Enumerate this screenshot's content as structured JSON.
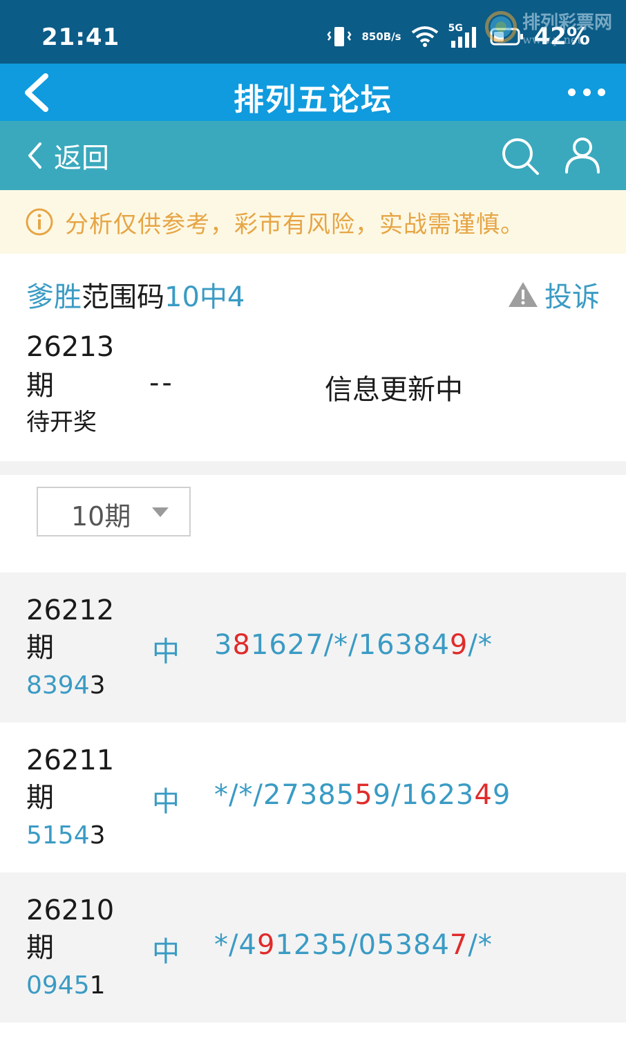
{
  "status_bar": {
    "time": "21:41",
    "speed_value": "850",
    "speed_unit": "B/s",
    "network": "5G",
    "battery": "42%",
    "watermark_text": "排列彩票网",
    "watermark_url": "www.p.net"
  },
  "title_bar": {
    "title": "排列五论坛"
  },
  "sub_nav": {
    "back_label": "返回"
  },
  "notice": {
    "text": "分析仅供参考，彩市有风险，实战需谨慎。"
  },
  "header": {
    "title_part1": "爹胜",
    "title_part2": "范围码",
    "title_part3": "10中4",
    "complain_label": "投诉"
  },
  "current": {
    "issue_number": "26213",
    "issue_suffix": "期",
    "status": "待开奖",
    "hit": "--",
    "info": "信息更新中"
  },
  "filter": {
    "selected": "10期"
  },
  "colors": {
    "status_bar": "#0b5c87",
    "title_bar": "#0f9bde",
    "sub_nav": "#3aa9bd",
    "notice_bg": "#fdf8e4",
    "notice_text": "#e6a545",
    "accent_blue": "#3a9bc4",
    "highlight_red": "#e02b2b"
  },
  "records": [
    {
      "issue_number": "26212",
      "issue_suffix": "期",
      "hit": "中",
      "draw": [
        {
          "t": "8394",
          "c": "blue"
        },
        {
          "t": "3",
          "c": "dark"
        }
      ],
      "prediction": [
        {
          "t": "3",
          "c": "blue"
        },
        {
          "t": "8",
          "c": "red"
        },
        {
          "t": "1627/*/16384",
          "c": "blue"
        },
        {
          "t": "9",
          "c": "red"
        },
        {
          "t": "/*",
          "c": "blue"
        }
      ]
    },
    {
      "issue_number": "26211",
      "issue_suffix": "期",
      "hit": "中",
      "draw": [
        {
          "t": "5154",
          "c": "blue"
        },
        {
          "t": "3",
          "c": "dark"
        }
      ],
      "prediction": [
        {
          "t": "*/*/27385",
          "c": "blue"
        },
        {
          "t": "5",
          "c": "red"
        },
        {
          "t": "9/1623",
          "c": "blue"
        },
        {
          "t": "4",
          "c": "red"
        },
        {
          "t": "9",
          "c": "blue"
        }
      ]
    },
    {
      "issue_number": "26210",
      "issue_suffix": "期",
      "hit": "中",
      "draw": [
        {
          "t": "0945",
          "c": "blue"
        },
        {
          "t": "1",
          "c": "dark"
        }
      ],
      "prediction": [
        {
          "t": "*/4",
          "c": "blue"
        },
        {
          "t": "9",
          "c": "red"
        },
        {
          "t": "1235/05384",
          "c": "blue"
        },
        {
          "t": "7",
          "c": "red"
        },
        {
          "t": "/*",
          "c": "blue"
        }
      ]
    }
  ]
}
